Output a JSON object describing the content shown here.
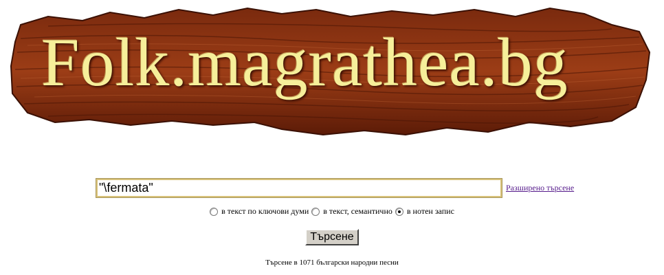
{
  "logo": {
    "text": "Folk.magrathea.bg"
  },
  "search": {
    "value": "\"\\fermata\"",
    "advanced_link": "Разширено търсене"
  },
  "modes": [
    {
      "label": "в текст по ключови думи",
      "checked": false
    },
    {
      "label": "в текст, семантично",
      "checked": false
    },
    {
      "label": "в нотен запис",
      "checked": true
    }
  ],
  "submit_label": "Търсене",
  "footer_note": "Търсене в 1071 български народни песни",
  "colors": {
    "logo_text": "#f6ef9a",
    "wood_dark": "#5a1a08",
    "wood_light": "#a8461c",
    "link": "#551a8b"
  }
}
